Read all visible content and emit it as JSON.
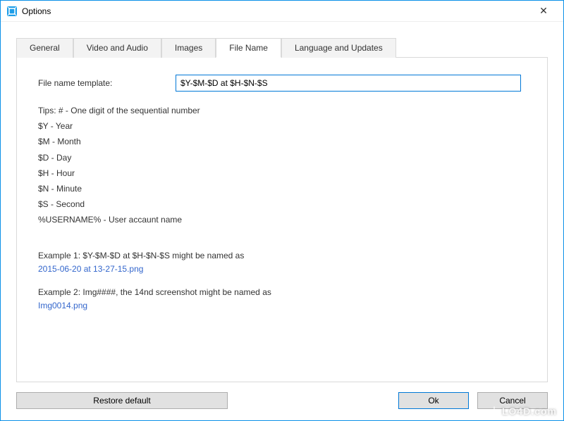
{
  "window": {
    "title": "Options",
    "close_label": "✕"
  },
  "tabs": {
    "general": "General",
    "video_audio": "Video and Audio",
    "images": "Images",
    "file_name": "File Name",
    "lang_updates": "Language and Updates"
  },
  "panel": {
    "template_label": "File name template:",
    "template_value": "$Y-$M-$D at $H-$N-$S",
    "tips_header": "Tips: # - One digit of the sequential number",
    "tip_year": "$Y - Year",
    "tip_month": "$M - Month",
    "tip_day": "$D - Day",
    "tip_hour": "$H - Hour",
    "tip_minute": "$N - Minute",
    "tip_second": "$S - Second",
    "tip_user": "%USERNAME% - User accaunt name",
    "example1_line1": "Example 1: $Y-$M-$D at $H-$N-$S might be named as",
    "example1_line2": "2015-06-20 at 13-27-15.png",
    "example2_line1": "Example 2: Img####, the 14nd screenshot might be named as",
    "example2_line2": "Img0014.png"
  },
  "buttons": {
    "restore": "Restore default",
    "ok": "Ok",
    "cancel": "Cancel"
  },
  "watermark": {
    "text": "LO4D.com"
  }
}
